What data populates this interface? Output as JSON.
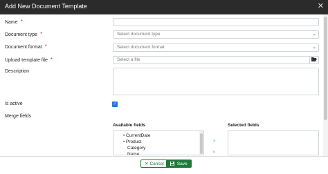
{
  "dialog": {
    "title": "Add New Document Template",
    "close_icon": "close-icon"
  },
  "form": {
    "name_label": "Name",
    "required_mark": "*",
    "doc_type_label": "Document type",
    "doc_type_placeholder": "Select document type",
    "doc_format_label": "Document format",
    "doc_format_placeholder": "Select document format",
    "upload_label": "Upload template file",
    "upload_placeholder": "Select a file",
    "upload_icon": "folder-open-icon",
    "description_label": "Description",
    "is_active_label": "Is active",
    "is_active_checked": true,
    "merge_fields_label": "Merge fields"
  },
  "merge": {
    "available_title": "Available fields",
    "selected_title": "Selected fields",
    "available_items": [
      {
        "label": "CurrentDate",
        "level": 1,
        "bullet": true
      },
      {
        "label": "Product",
        "level": 1,
        "bullet": true
      },
      {
        "label": "Category",
        "level": 2,
        "bullet": false
      },
      {
        "label": "Name",
        "level": 2,
        "bullet": false
      }
    ],
    "move_right_icon": "chevron-right-icon",
    "move_left_icon": "chevron-left-icon"
  },
  "footer": {
    "cancel_label": "Cancel",
    "save_label": "Save",
    "cancel_icon": "close-icon",
    "save_icon": "floppy-icon"
  },
  "colors": {
    "accent": "#1f7a3a",
    "checkbox": "#1e73e8",
    "required": "#d9363e",
    "titlebar": "#2b2b2b"
  }
}
